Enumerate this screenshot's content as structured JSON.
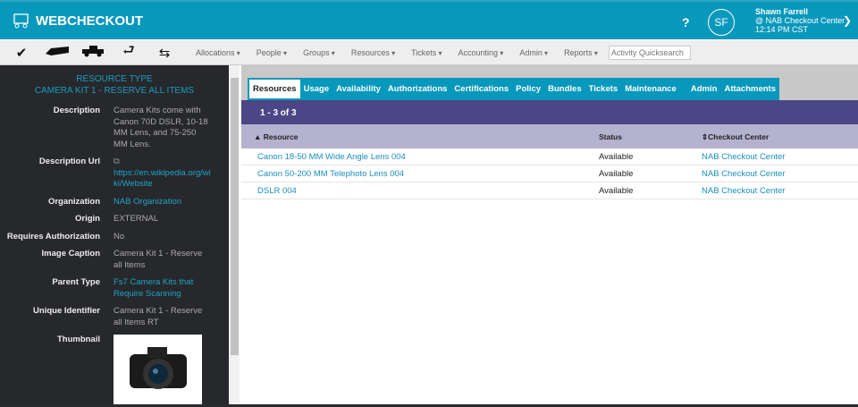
{
  "header": {
    "brand": "WEBCHECKOUT",
    "help": "?",
    "avatar_initials": "SF",
    "user_name": "Shawn Farrell",
    "user_center": "@ NAB Checkout Center",
    "user_time": "12:14 PM CST"
  },
  "toolbar": {
    "icons": [
      "checkmark-icon",
      "scanner-icon",
      "truck-icon",
      "return-icon",
      "swap-icon"
    ],
    "menus": [
      "Allocations",
      "People",
      "Groups",
      "Resources",
      "Tickets",
      "Accounting",
      "Admin",
      "Reports"
    ],
    "search_placeholder": "Activity Quicksearch"
  },
  "left": {
    "title1": "RESOURCE TYPE",
    "title2": "CAMERA KIT 1 - RESERVE ALL ITEMS",
    "fields": [
      {
        "label": "Description",
        "value": "Camera Kits come with Canon 70D DSLR, 10-18 MM Lens, and 75-250 MM Lens."
      },
      {
        "label": "Description Url",
        "value": "https://en.wikipedia.org/wiki/Website"
      },
      {
        "label": "Organization",
        "value": "NAB Organization"
      },
      {
        "label": "Origin",
        "value": "EXTERNAL"
      },
      {
        "label": "Requires Authorization",
        "value": "No"
      },
      {
        "label": "Image Caption",
        "value": "Camera Kit 1 - Reserve all Items"
      },
      {
        "label": "Parent Type",
        "value": "Fs7 Camera Kits that Require Scanning"
      },
      {
        "label": "Unique Identifier",
        "value": "Camera Kit 1 - Reserve all Items RT"
      },
      {
        "label": "Thumbnail",
        "value": ""
      }
    ]
  },
  "tabs": [
    "Resources",
    "Usage",
    "Availability",
    "Authorizations",
    "Certifications",
    "Policy",
    "Bundles",
    "Tickets",
    "Maintenance Schedules",
    "Admin",
    "Attachments"
  ],
  "table": {
    "count": "1 - 3 of 3",
    "headers": [
      "Resource",
      "Status",
      "Checkout Center"
    ],
    "rows": [
      [
        "Canon 18-50 MM Wide Angle Lens 004",
        "Available",
        "NAB Checkout Center"
      ],
      [
        "Canon 50-200 MM Telephoto Lens 004",
        "Available",
        "NAB Checkout Center"
      ],
      [
        "DSLR 004",
        "Available",
        "NAB Checkout Center"
      ]
    ]
  }
}
